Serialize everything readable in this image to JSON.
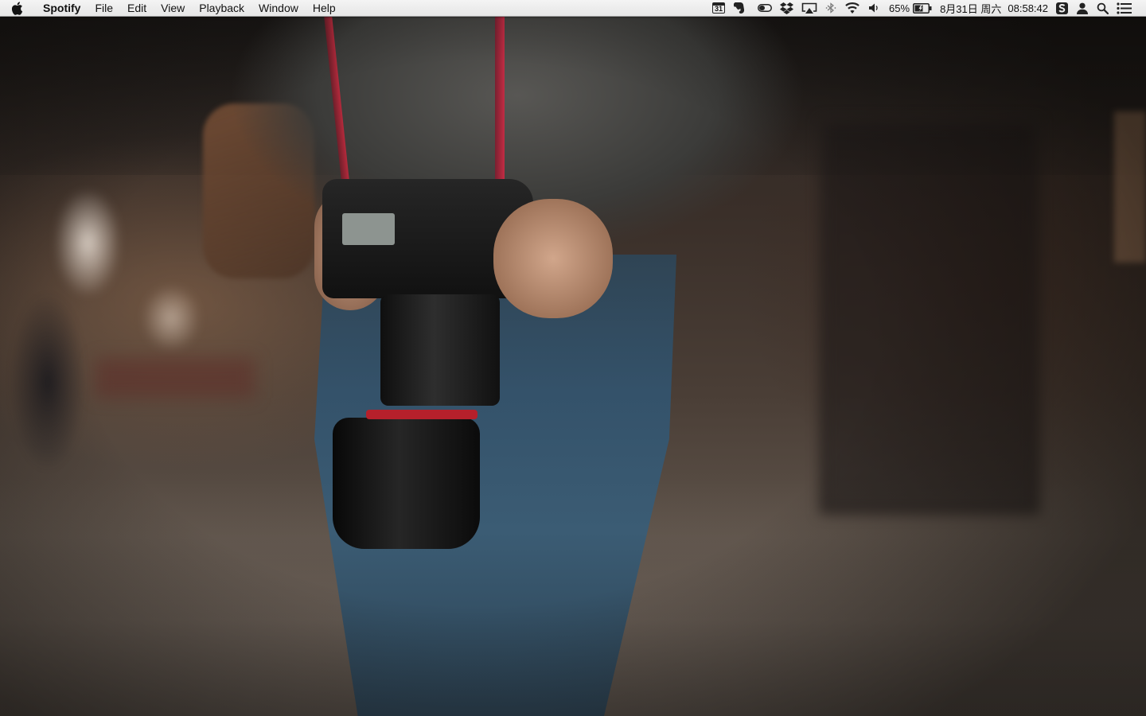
{
  "menubar": {
    "apple_icon": "apple-icon",
    "app_name": "Spotify",
    "menus": [
      "File",
      "Edit",
      "View",
      "Playback",
      "Window",
      "Help"
    ],
    "status": {
      "calendar_day": "31",
      "battery_percent": "65%",
      "date": "8月31日 周六",
      "time": "08:58:42"
    }
  },
  "wallpaper": {
    "description_colors": {
      "jacket": "#4a4a48",
      "jeans": "#34526a",
      "strap": "#b52a3c"
    }
  }
}
